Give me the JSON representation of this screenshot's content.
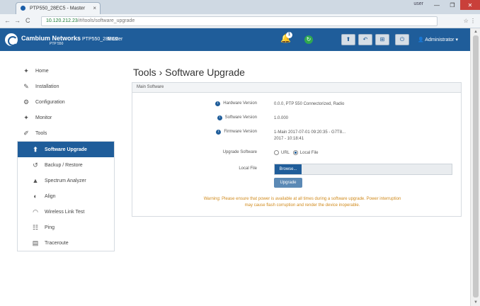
{
  "browser": {
    "tab_title": "PTP550_28EC5 - Master",
    "tab_close": "×",
    "profile": "user",
    "window_buttons": [
      "—",
      "❐",
      "✕"
    ],
    "back": "←",
    "forward": "→",
    "reload": "C",
    "url_host": "10.120.212.23",
    "url_path": "/#/tools/software_upgrade",
    "addr_right": "☆ ⋮"
  },
  "header": {
    "brand": "Cambium Networks",
    "model": "PTP 550",
    "device_name": "PTP550_28EC5",
    "mode": "Master",
    "bell_count": "1",
    "status_icon": "↻",
    "buttons": [
      "⬆",
      "↶",
      "⊞",
      "⏻"
    ],
    "admin": "Administrator"
  },
  "sidebar": {
    "items": [
      {
        "icon": "✦",
        "label": "Home",
        "name": "sidebar-item-home"
      },
      {
        "icon": "✎",
        "label": "Installation",
        "name": "sidebar-item-installation"
      },
      {
        "icon": "⚙",
        "label": "Configuration",
        "name": "sidebar-item-configuration"
      },
      {
        "icon": "✦",
        "label": "Monitor",
        "name": "sidebar-item-monitor"
      },
      {
        "icon": "✐",
        "label": "Tools",
        "name": "sidebar-item-tools"
      }
    ],
    "sub_items": [
      {
        "icon": "⬆",
        "label": "Software Upgrade",
        "name": "sidebar-item-software-upgrade",
        "active": true
      },
      {
        "icon": "↺",
        "label": "Backup / Restore",
        "name": "sidebar-item-backup-restore"
      },
      {
        "icon": "▲",
        "label": "Spectrum Analyzer",
        "name": "sidebar-item-spectrum-analyzer"
      },
      {
        "icon": "◐",
        "label": "Align",
        "name": "sidebar-item-align"
      },
      {
        "icon": "◠",
        "label": "Wireless Link Test",
        "name": "sidebar-item-wireless-link-test"
      },
      {
        "icon": "☷",
        "label": "Ping",
        "name": "sidebar-item-ping"
      },
      {
        "icon": "▤",
        "label": "Traceroute",
        "name": "sidebar-item-traceroute"
      }
    ]
  },
  "main": {
    "page_title": "Tools › Software Upgrade",
    "panel_title": "Main Software",
    "hardware_label": "Hardware Version",
    "hardware_value": "0.0.0, PTP 550 Connectorized, Radio",
    "software_label": "Software Version",
    "software_value": "1.0.000",
    "firmware_label": "Firmware Version",
    "firmware_value": "1-Main 2017-07-01 09:20:35 - G7T8...",
    "firmware_value2": "2017 - 10:18:41",
    "upgrade_label": "Upgrade Software",
    "opt_url": "URL",
    "opt_local": "Local File",
    "local_file_label": "Local File",
    "browse": "Browse...",
    "upgrade_button": "Upgrade",
    "warning1": "Warning: Please ensure that power is available at all times during a software upgrade. Power interruption",
    "warning2": "may cause flash corruption and render the device inoperable."
  },
  "colors": {
    "brand": "#1f5d9a",
    "warning": "#d08a1c",
    "status_ok": "#2fa84f"
  }
}
